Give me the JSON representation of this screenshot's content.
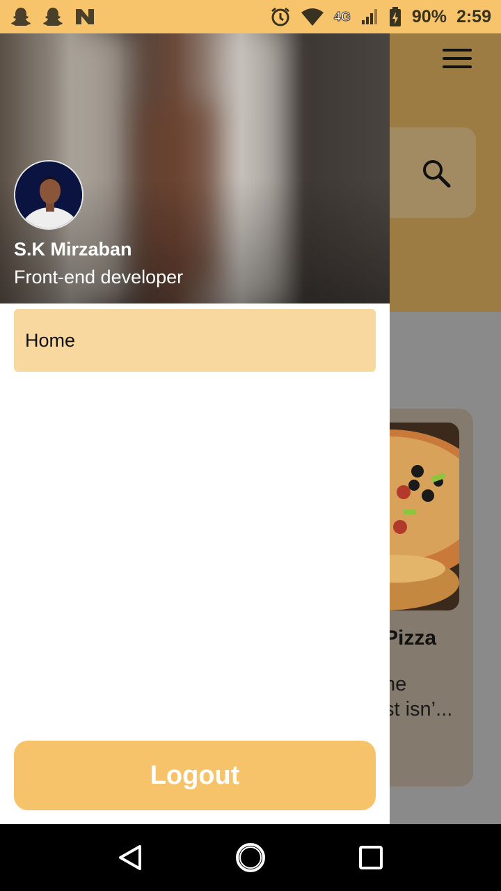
{
  "status_bar": {
    "battery": "90%",
    "time": "2:59",
    "network": "4G"
  },
  "profile": {
    "name": "S.K Mirzaban",
    "role": "Front-end developer"
  },
  "menu": {
    "items": [
      {
        "label": "Home",
        "icon": "none"
      }
    ]
  },
  "actions": {
    "logout_label": "Logout"
  },
  "background_app": {
    "card_title": "Pizza",
    "card_desc": "he\nst isn’..."
  },
  "colors": {
    "accent": "#f6c36b",
    "menu_active": "#f9d8a0",
    "status_bar": "#f7c46c"
  }
}
